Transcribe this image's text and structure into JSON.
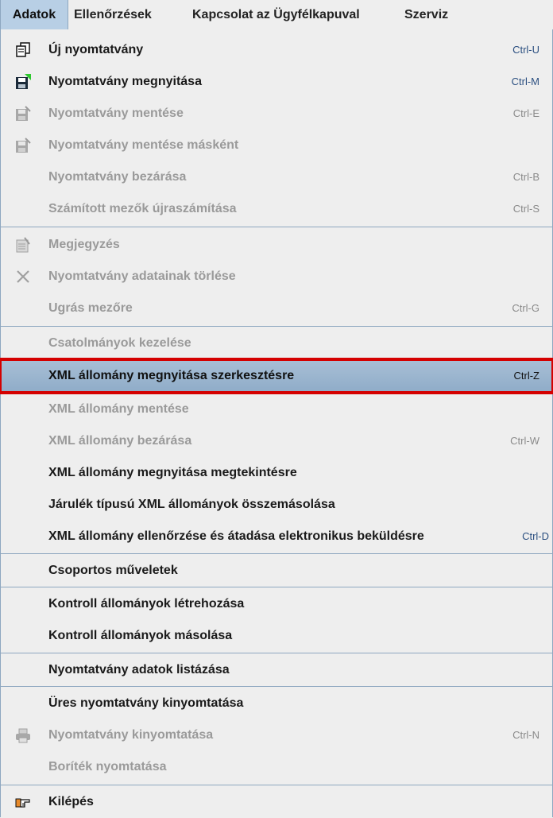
{
  "menubar": {
    "items": [
      "Adatok",
      "Ellenőrzések",
      "Kapcsolat az Ügyfélkapuval",
      "Szerviz"
    ]
  },
  "menu": {
    "items": [
      {
        "label": "Új nyomtatvány",
        "shortcut": "Ctrl-U",
        "icon": "new-form-icon"
      },
      {
        "label": "Nyomtatvány megnyitása",
        "shortcut": "Ctrl-M",
        "icon": "open-form-icon"
      },
      {
        "label": "Nyomtatvány mentése",
        "shortcut": "Ctrl-E",
        "icon": "save-form-icon"
      },
      {
        "label": "Nyomtatvány mentése másként",
        "shortcut": "",
        "icon": "save-as-icon"
      },
      {
        "label": "Nyomtatvány bezárása",
        "shortcut": "Ctrl-B"
      },
      {
        "label": "Számított mezők újraszámítása",
        "shortcut": "Ctrl-S"
      },
      {
        "label": "Megjegyzés",
        "shortcut": "",
        "icon": "note-icon"
      },
      {
        "label": "Nyomtatvány adatainak törlése",
        "shortcut": "",
        "icon": "delete-icon"
      },
      {
        "label": "Ugrás mezőre",
        "shortcut": "Ctrl-G"
      },
      {
        "label": "Csatolmányok kezelése",
        "shortcut": ""
      },
      {
        "label": "XML állomány megnyitása szerkesztésre",
        "shortcut": "Ctrl-Z"
      },
      {
        "label": "XML állomány mentése",
        "shortcut": ""
      },
      {
        "label": "XML állomány bezárása",
        "shortcut": "Ctrl-W"
      },
      {
        "label": "XML állomány megnyitása megtekintésre",
        "shortcut": ""
      },
      {
        "label": "Járulék típusú XML állományok összemásolása",
        "shortcut": ""
      },
      {
        "label": "XML állomány ellenőrzése és átadása elektronikus beküldésre",
        "shortcut": "Ctrl-D"
      },
      {
        "label": "Csoportos műveletek",
        "shortcut": ""
      },
      {
        "label": "Kontroll állományok létrehozása",
        "shortcut": ""
      },
      {
        "label": "Kontroll állományok másolása",
        "shortcut": ""
      },
      {
        "label": "Nyomtatvány adatok listázása",
        "shortcut": ""
      },
      {
        "label": "Üres nyomtatvány kinyomtatása",
        "shortcut": ""
      },
      {
        "label": "Nyomtatvány kinyomtatása",
        "shortcut": "Ctrl-N",
        "icon": "printer-icon"
      },
      {
        "label": "Boríték nyomtatása",
        "shortcut": ""
      },
      {
        "label": "Kilépés",
        "shortcut": "",
        "icon": "exit-hand-icon"
      }
    ]
  },
  "colors": {
    "highlight": "#9fb8d0",
    "highlight_border": "#d40000",
    "separator": "#8ea7c0"
  }
}
